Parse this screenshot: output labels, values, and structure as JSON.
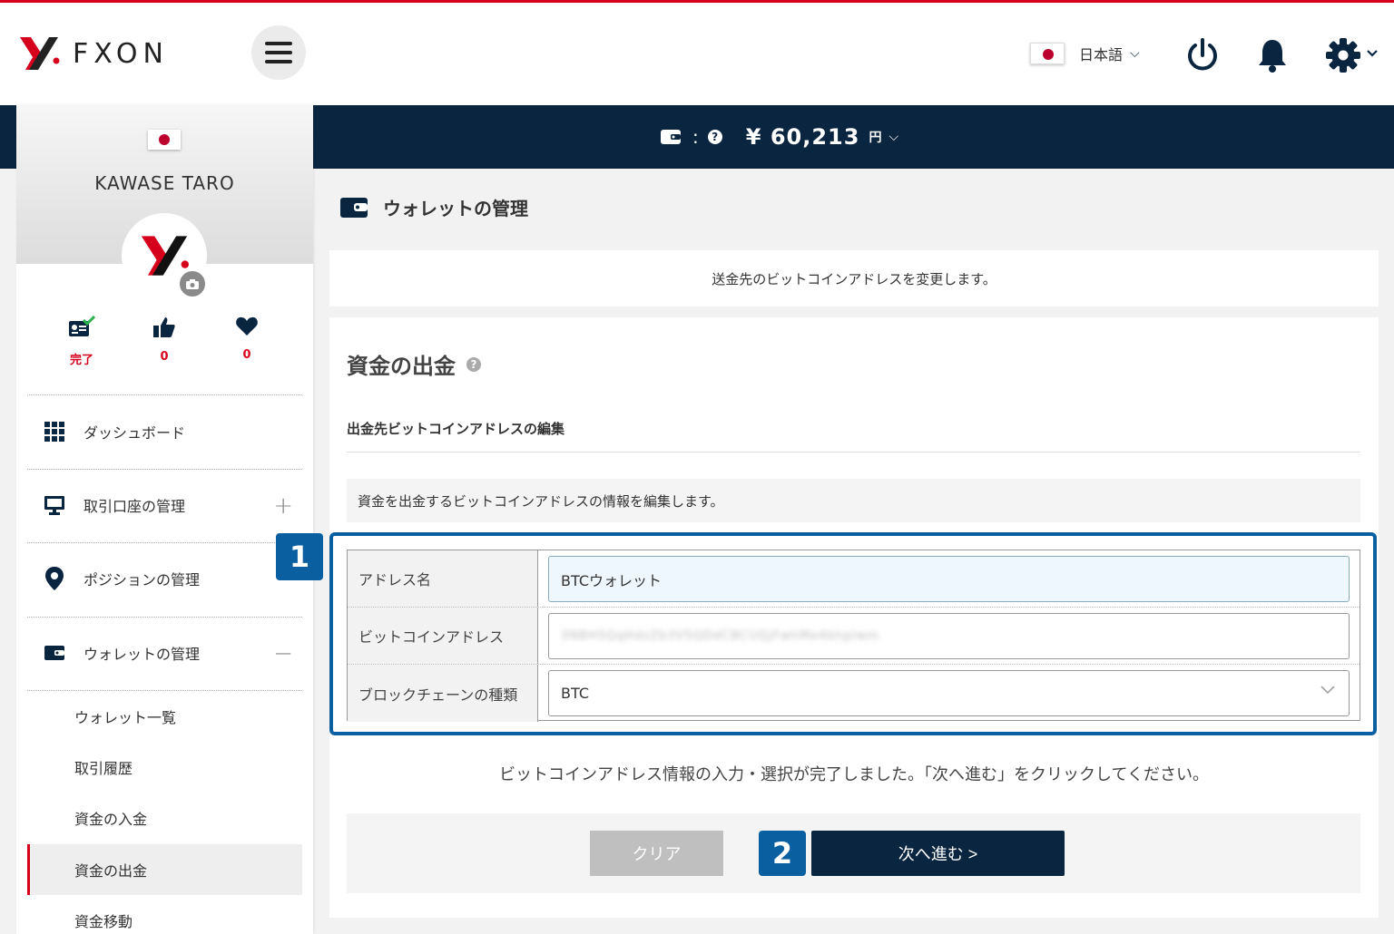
{
  "header": {
    "brand": "FXON",
    "language": "日本語"
  },
  "balance": {
    "currency_symbol": "¥",
    "amount": "60,213",
    "unit": "円"
  },
  "sidebar": {
    "user_name": "KAWASE TARO",
    "stats": [
      {
        "icon": "id-card-check-icon",
        "value": "完了"
      },
      {
        "icon": "thumbs-up-icon",
        "value": "0"
      },
      {
        "icon": "heart-icon",
        "value": "0"
      }
    ],
    "nav": [
      {
        "icon": "grid-icon",
        "label": "ダッシュボード"
      },
      {
        "icon": "monitor-icon",
        "label": "取引口座の管理",
        "toggle": "+"
      },
      {
        "icon": "map-pin-icon",
        "label": "ポジションの管理"
      },
      {
        "icon": "wallet-icon",
        "label": "ウォレットの管理",
        "toggle": "−"
      }
    ],
    "sub_nav": [
      {
        "label": "ウォレット一覧"
      },
      {
        "label": "取引履歴"
      },
      {
        "label": "資金の入金"
      },
      {
        "label": "資金の出金"
      },
      {
        "label": "資金移動"
      }
    ]
  },
  "page": {
    "title": "ウォレットの管理",
    "info": "送金先のビットコインアドレスを変更します。"
  },
  "card": {
    "title": "資金の出金",
    "subtitle": "出金先ビットコインアドレスの編集",
    "note": "資金を出金するビットコインアドレスの情報を編集します。",
    "fields": [
      {
        "label": "アドレス名",
        "value": "BTCウォレット"
      },
      {
        "label": "ビットコインアドレス",
        "value": "3NBHSQqHdsZb3VSQDdCBCUQjFwhMe4bhpIwm"
      },
      {
        "label": "ブロックチェーンの種類",
        "value": "BTC"
      }
    ],
    "done_text": "ビットコインアドレス情報の入力・選択が完了しました。「次へ進む」をクリックしてください。",
    "clear_label": "クリア",
    "next_label": "次へ進む >",
    "badges": [
      "1",
      "2"
    ]
  },
  "colors": {
    "brand_red": "#d6001c",
    "navy": "#0a2540",
    "badge_blue": "#0a5fa0"
  }
}
